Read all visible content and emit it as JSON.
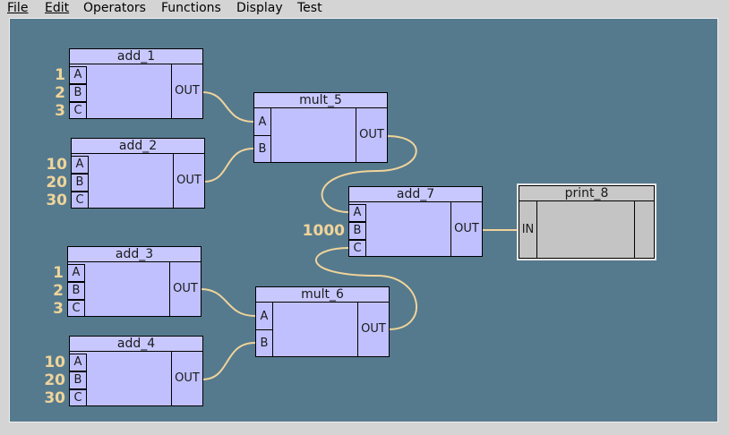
{
  "menu": [
    {
      "label": "File",
      "id": "file"
    },
    {
      "label": "Edit",
      "id": "edit"
    },
    {
      "label": "Operators",
      "id": "operators"
    },
    {
      "label": "Functions",
      "id": "functions"
    },
    {
      "label": "Display",
      "id": "display"
    },
    {
      "label": "Test",
      "id": "test"
    }
  ],
  "nodes": {
    "add_1": {
      "title": "add_1",
      "inputs": [
        "A",
        "B",
        "C"
      ],
      "output": "OUT"
    },
    "add_2": {
      "title": "add_2",
      "inputs": [
        "A",
        "B",
        "C"
      ],
      "output": "OUT"
    },
    "add_3": {
      "title": "add_3",
      "inputs": [
        "A",
        "B",
        "C"
      ],
      "output": "OUT"
    },
    "add_4": {
      "title": "add_4",
      "inputs": [
        "A",
        "B",
        "C"
      ],
      "output": "OUT"
    },
    "mult_5": {
      "title": "mult_5",
      "inputs": [
        "A",
        "B"
      ],
      "output": "OUT"
    },
    "mult_6": {
      "title": "mult_6",
      "inputs": [
        "A",
        "B"
      ],
      "output": "OUT"
    },
    "add_7": {
      "title": "add_7",
      "inputs": [
        "A",
        "B",
        "C"
      ],
      "output": "OUT"
    },
    "print_8": {
      "title": "print_8",
      "inputs": [
        "IN"
      ],
      "output": ""
    }
  },
  "constants": {
    "add_1": [
      "1",
      "2",
      "3"
    ],
    "add_2": [
      "10",
      "20",
      "30"
    ],
    "add_3": [
      "1",
      "2",
      "3"
    ],
    "add_4": [
      "10",
      "20",
      "30"
    ],
    "add_7_b": "1000"
  },
  "colors": {
    "canvas": "#557a8e",
    "node": "#c0c0ff",
    "print_node": "#c4c4c4",
    "wire": "#f0d49a",
    "constant": "#f0d49a"
  }
}
